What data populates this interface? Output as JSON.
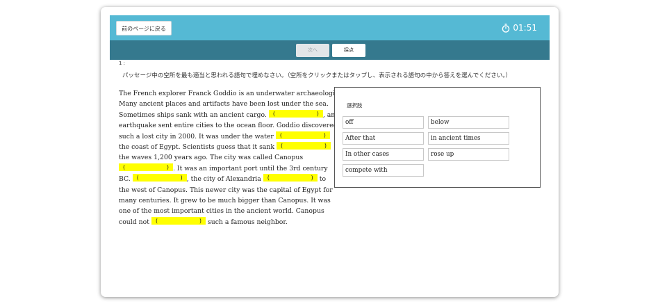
{
  "header": {
    "back_label": "前のページに戻る",
    "timer": "01:51",
    "timer_icon": "stopwatch-icon"
  },
  "toolbar": {
    "next_label": "次へ",
    "grade_label": "採点"
  },
  "question": {
    "number": "1 :",
    "instruction": "パッセージ中の空所を最も適当と思われる語句で埋めなさい。（空所をクリックまたはタップし、表示される語句の中から答えを選んでください。）"
  },
  "passage": {
    "lines": [
      "The French explorer Franck Goddio is an underwater archaeologist.",
      "Many ancient places and artifacts have been lost under the sea.",
      "Sometimes ships sank with an ancient cargo.",
      ", an",
      "earthquake sent entire cities to the ocean floor. Goddio discovered",
      "such a lost city in 2000. It was under the water",
      "the coast of Egypt. Scientists guess that it sank",
      "the waves 1,200 years ago. The city was called Canopus",
      ". It was an important port until the 3rd century",
      "BC.",
      ", the city of Alexandria",
      "to",
      "the west of Canopus. This newer city was the capital of Egypt for",
      "many centuries. It grew to be much bigger than Canopus. It was",
      "one of the most important cities in the ancient world. Canopus",
      "could not",
      "such a famous neighbor."
    ],
    "blank_open": "(",
    "blank_close": ")"
  },
  "choices": {
    "title": "選択肢",
    "items": [
      "off",
      "below",
      "After that",
      "in ancient times",
      "In other cases",
      "rose up",
      "compete with"
    ]
  },
  "colors": {
    "header_bar": "#55b9d4",
    "sub_bar": "#35798e",
    "blank_highlight": "#ffff00"
  }
}
